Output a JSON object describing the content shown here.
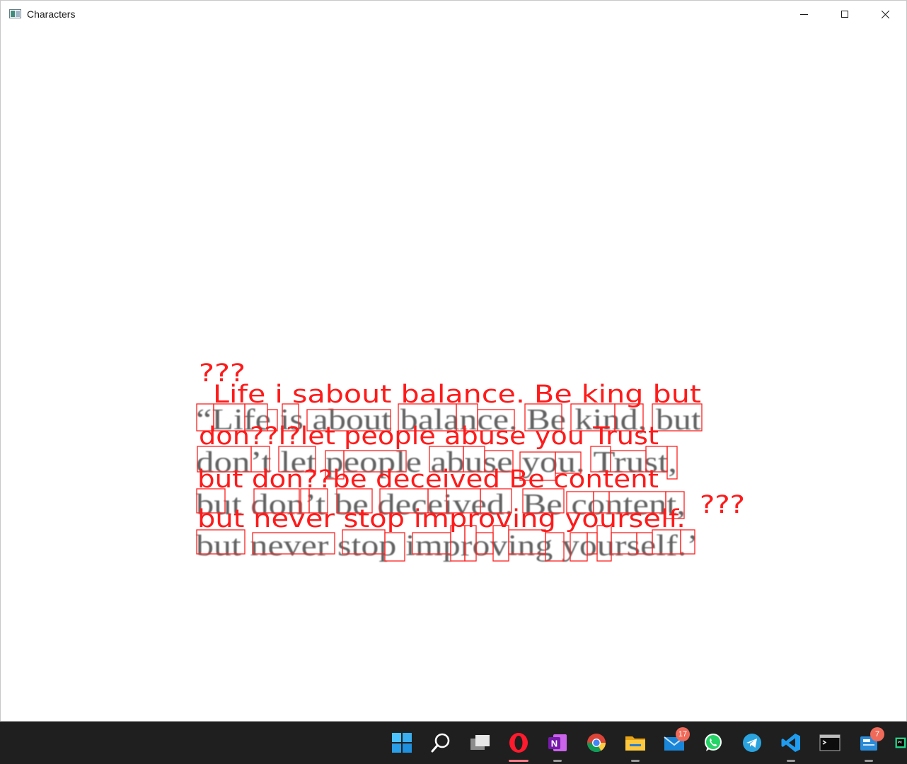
{
  "window": {
    "title": "Characters",
    "icon": "app-window-icon",
    "controls": [
      "minimize-icon",
      "maximize-icon",
      "close-icon"
    ]
  },
  "image": {
    "source_lines": [
      "“Life is about balance. Be kind, but",
      "don’t let people abuse you. Trust,",
      "but don’t be deceived. Be content,",
      "but never stop improving yourself.’"
    ],
    "recognized_lines": [
      "???",
      "Life i sabout balance.  Be king  but",
      "don??l?let people abuse  you  Trust",
      "but  don??be deceived  Be content",
      "???",
      "but never stop improving yourself."
    ],
    "highlight_color": "#ff0000"
  },
  "taskbar": {
    "items": [
      {
        "name": "start-icon"
      },
      {
        "name": "search-icon"
      },
      {
        "name": "task-view-icon"
      },
      {
        "name": "opera-icon",
        "active": true
      },
      {
        "name": "onenote-icon",
        "label": "N",
        "running": true
      },
      {
        "name": "chrome-icon"
      },
      {
        "name": "file-explorer-icon",
        "running": true
      },
      {
        "name": "mail-icon",
        "badge": "17"
      },
      {
        "name": "whatsapp-icon"
      },
      {
        "name": "telegram-icon"
      },
      {
        "name": "vscode-icon",
        "running": true
      },
      {
        "name": "terminal-icon"
      },
      {
        "name": "news-icon",
        "badge": "7",
        "running": true
      },
      {
        "name": "pycharm-icon",
        "label": "PC"
      }
    ]
  }
}
